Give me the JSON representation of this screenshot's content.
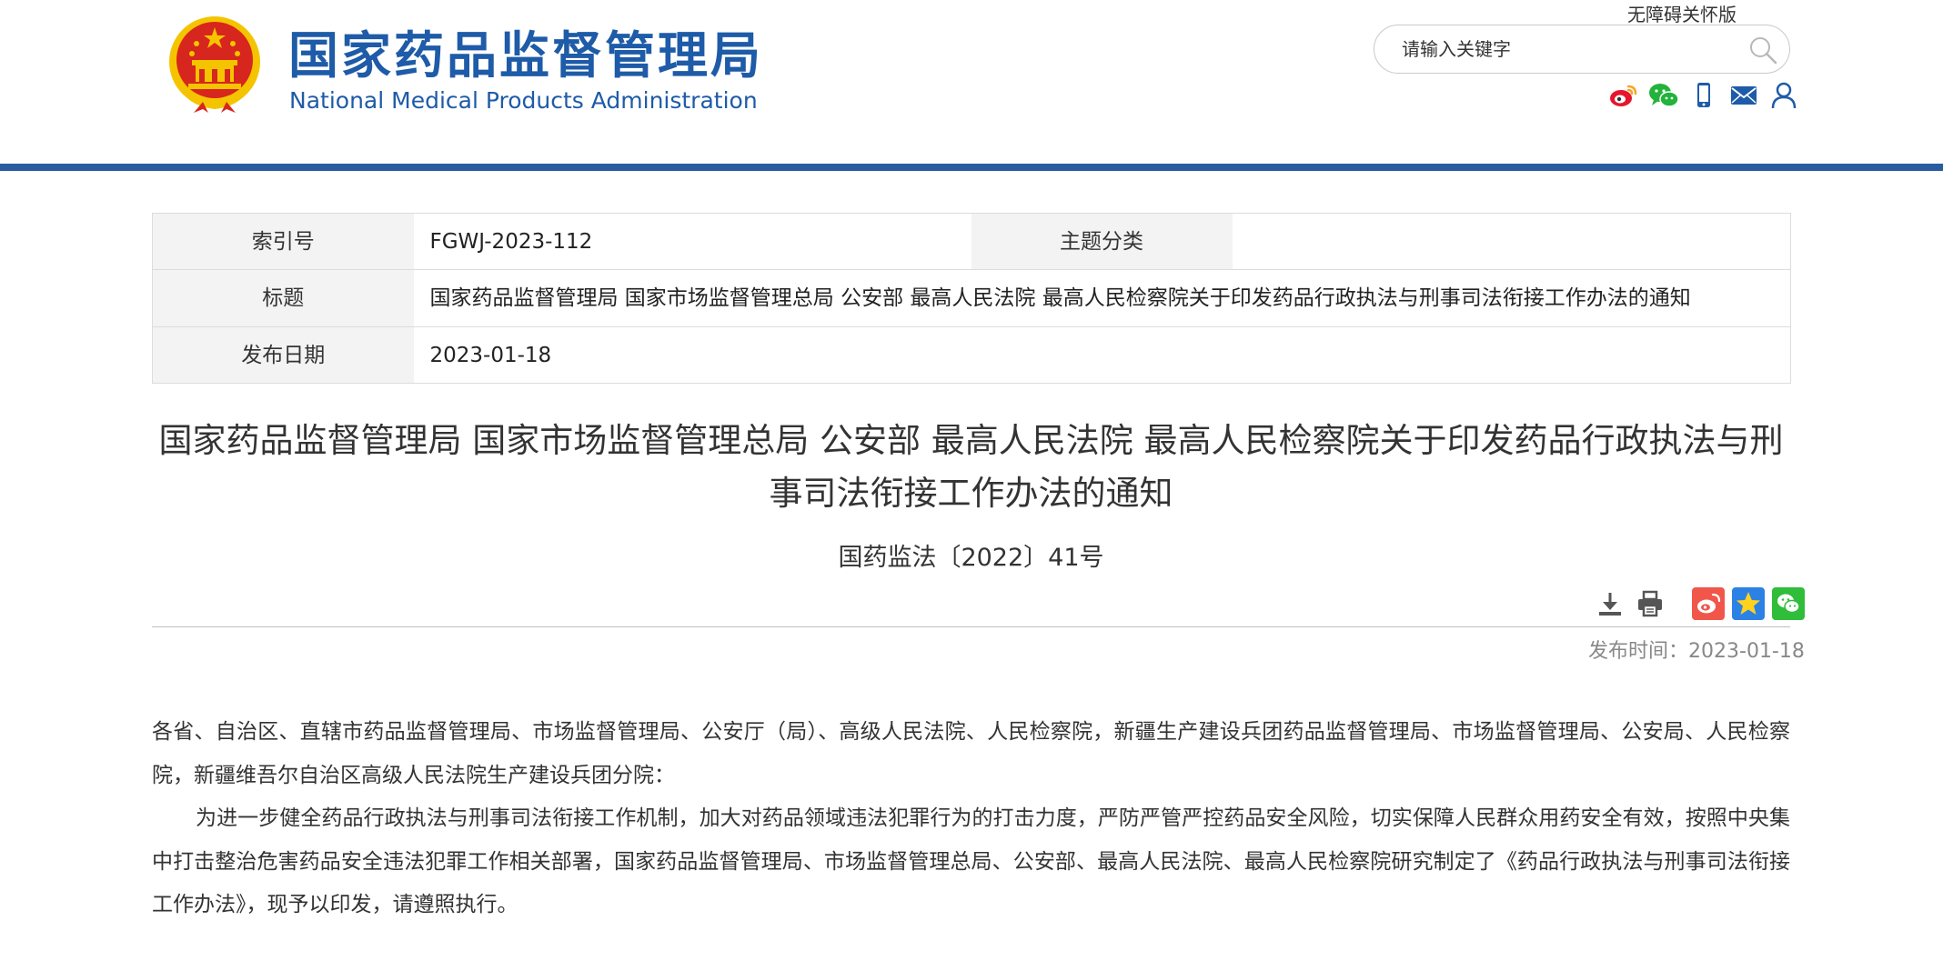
{
  "header": {
    "site_title_cn": "国家药品监督管理局",
    "site_title_en": "National Medical Products Administration",
    "accessibility_link": "无障碍关怀版",
    "search_placeholder": "请输入关键字",
    "social_icons": [
      "weibo-icon",
      "wechat-icon",
      "mobile-icon",
      "mail-icon",
      "user-icon"
    ]
  },
  "meta": {
    "index_label": "索引号",
    "index_value": "FGWJ-2023-112",
    "category_label": "主题分类",
    "category_value": "",
    "title_label": "标题",
    "title_value": "国家药品监督管理局 国家市场监督管理总局 公安部 最高人民法院 最高人民检察院关于印发药品行政执法与刑事司法衔接工作办法的通知",
    "date_label": "发布日期",
    "date_value": "2023-01-18"
  },
  "article": {
    "title": "国家药品监督管理局 国家市场监督管理总局 公安部 最高人民法院 最高人民检察院关于印发药品行政执法与刑事司法衔接工作办法的通知",
    "doc_number": "国药监法〔2022〕41号",
    "publish_time_label": "发布时间：",
    "publish_time_value": "2023-01-18",
    "paragraphs": [
      "各省、自治区、直辖市药品监督管理局、市场监督管理局、公安厅（局）、高级人民法院、人民检察院，新疆生产建设兵团药品监督管理局、市场监督管理局、公安局、人民检察院，新疆维吾尔自治区高级人民法院生产建设兵团分院：",
      "为进一步健全药品行政执法与刑事司法衔接工作机制，加大对药品领域违法犯罪行为的打击力度，严防严管严控药品安全风险，切实保障人民群众用药安全有效，按照中央集中打击整治危害药品安全违法犯罪工作相关部署，国家药品监督管理局、市场监督管理总局、公安部、最高人民法院、最高人民检察院研究制定了《药品行政执法与刑事司法衔接工作办法》，现予以印发，请遵照执行。"
    ]
  },
  "toolbar": {
    "icons": [
      "download-icon",
      "print-icon",
      "share-weibo-icon",
      "share-qzone-icon",
      "share-wechat-icon"
    ]
  },
  "colors": {
    "brand_blue": "#1e5ba8",
    "header_bar": "#2a5c9f",
    "emblem_red": "#d7261d",
    "emblem_gold": "#f5c400"
  }
}
